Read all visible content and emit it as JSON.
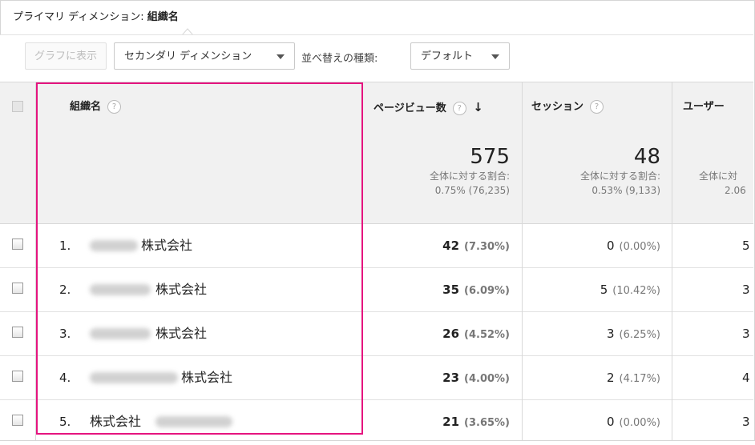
{
  "primary_dimension": {
    "label": "プライマリ ディメンション:",
    "value": "組織名"
  },
  "toolbar": {
    "graph_button": "グラフに表示",
    "secondary_dimension": "セカンダリ ディメンション",
    "sort_label": "並べ替えの種類:",
    "sort_value": "デフォルト"
  },
  "columns": {
    "org": "組織名",
    "pageviews": "ページビュー数",
    "sessions": "セッション",
    "users": "ユーザー",
    "help": "?",
    "sort_arrow": "↓"
  },
  "totals": {
    "pageviews": {
      "value": "575",
      "label": "全体に対する割合:",
      "pct": "0.75% (76,235)"
    },
    "sessions": {
      "value": "48",
      "label": "全体に対する割合:",
      "pct": "0.53% (9,133)"
    },
    "users": {
      "label": "全体に対",
      "pct": "2.06"
    }
  },
  "rows": [
    {
      "rank": "1.",
      "name": "株式会社",
      "pv": "42",
      "pv_pct": "(7.30%)",
      "sess": "0",
      "sess_pct": "(0.00%)",
      "users": "5"
    },
    {
      "rank": "2.",
      "name": "株式会社",
      "pv": "35",
      "pv_pct": "(6.09%)",
      "sess": "5",
      "sess_pct": "(10.42%)",
      "users": "3"
    },
    {
      "rank": "3.",
      "name": "株式会社",
      "pv": "26",
      "pv_pct": "(4.52%)",
      "sess": "3",
      "sess_pct": "(6.25%)",
      "users": "3"
    },
    {
      "rank": "4.",
      "name": "株式会社",
      "pv": "23",
      "pv_pct": "(4.00%)",
      "sess": "2",
      "sess_pct": "(4.17%)",
      "users": "4"
    },
    {
      "rank": "5.",
      "name": "株式会社",
      "pv": "21",
      "pv_pct": "(3.65%)",
      "sess": "0",
      "sess_pct": "(0.00%)",
      "users": "3"
    }
  ],
  "colors": {
    "highlight": "#e5147f",
    "header_bg": "#f1f1f1"
  }
}
